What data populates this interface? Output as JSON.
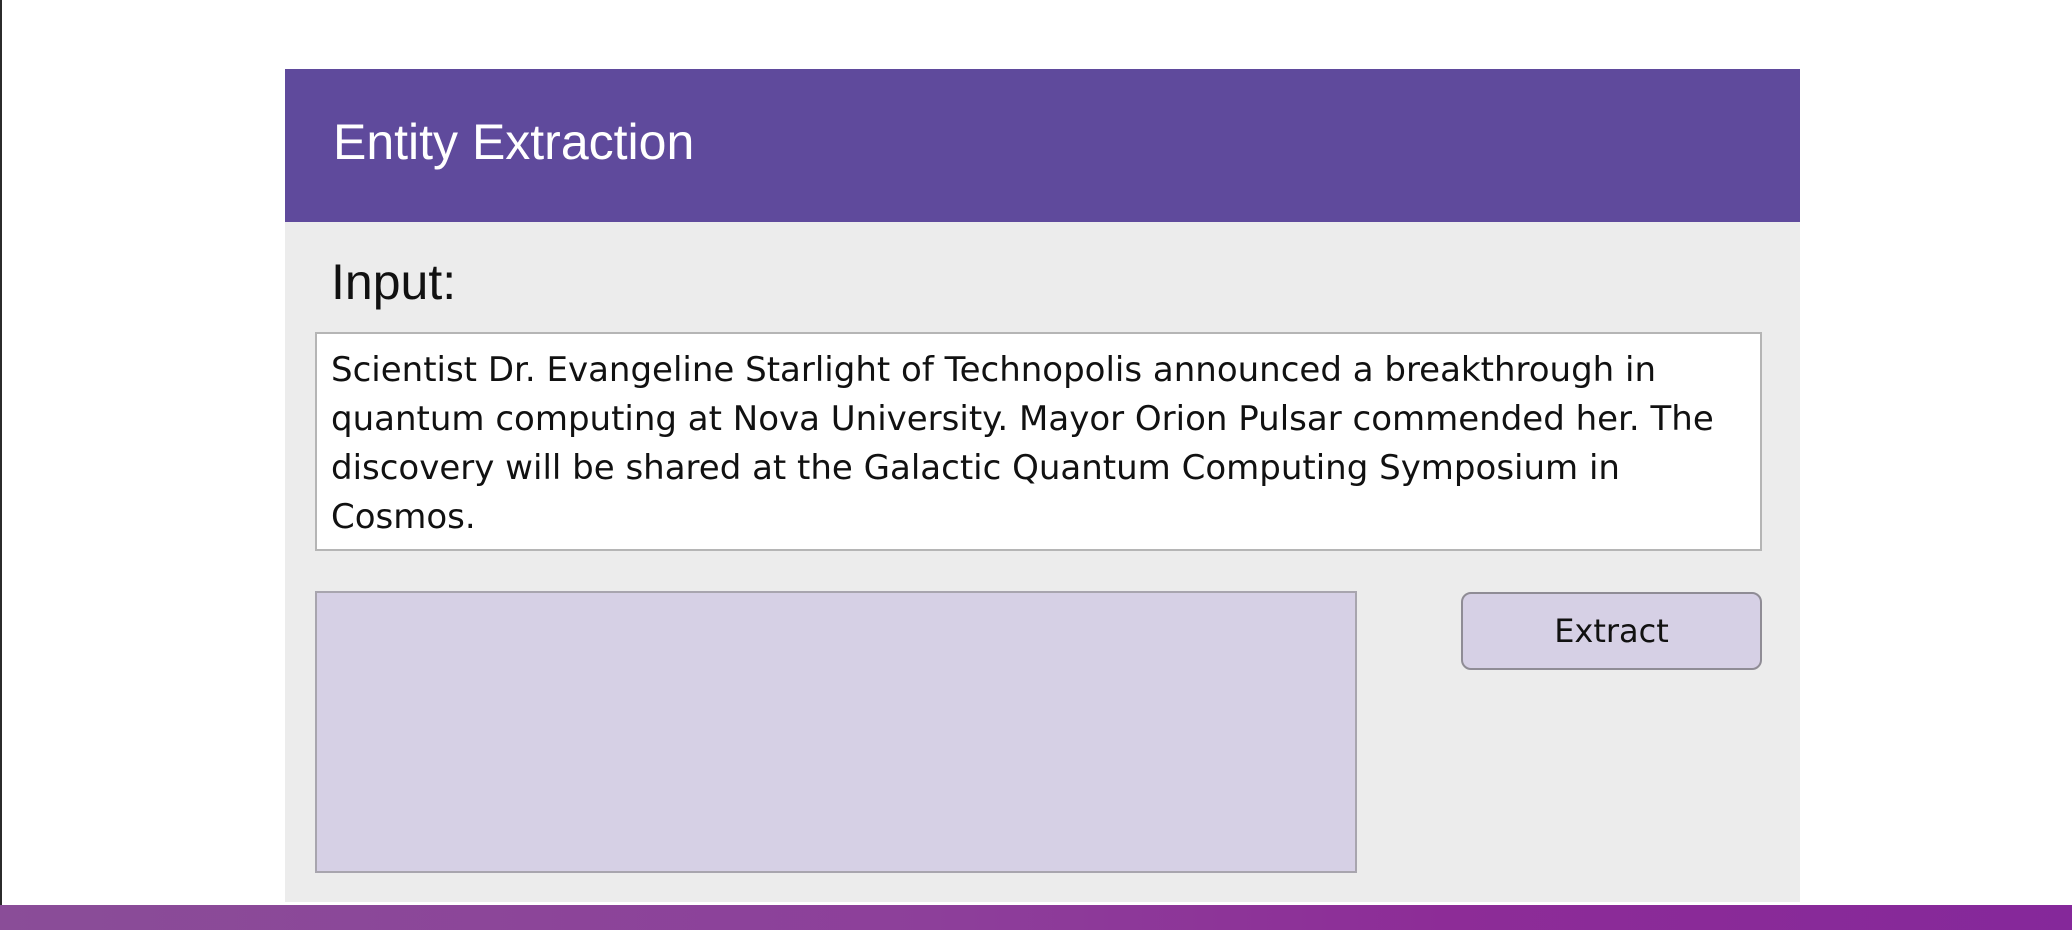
{
  "header": {
    "title": "Entity Extraction"
  },
  "input": {
    "label": "Input:",
    "value": "Scientist Dr. Evangeline Starlight of Technopolis announced a breakthrough in quantum computing at Nova University. Mayor Orion Pulsar commended her. The discovery will be shared at the Galactic Quantum Computing Symposium in Cosmos."
  },
  "output": {
    "value": ""
  },
  "actions": {
    "extract_label": "Extract"
  },
  "colors": {
    "header": "#5f4a9c",
    "panel": "#ececec",
    "output_box": "#d6d0e5",
    "button": "#d6d0e5",
    "bottom_bar": "#8d2c97"
  }
}
